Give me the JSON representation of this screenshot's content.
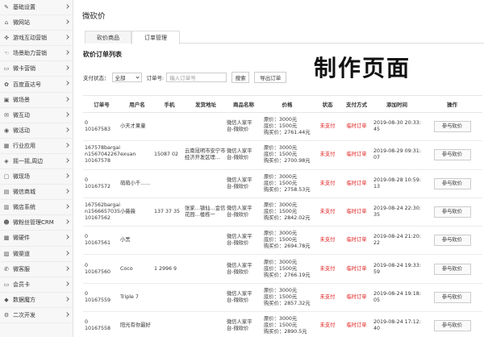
{
  "sidebar": {
    "items": [
      {
        "label": "基础设置",
        "icon": "wrench-icon",
        "glyph": "✎"
      },
      {
        "label": "微网站",
        "icon": "home-icon",
        "glyph": "⌂"
      },
      {
        "label": "游戏互动营销",
        "icon": "gamepad-icon",
        "glyph": "✜"
      },
      {
        "label": "场景助力营销",
        "icon": "hand-icon",
        "glyph": "☜"
      },
      {
        "label": "微卡营销",
        "icon": "card-icon",
        "glyph": "▭"
      },
      {
        "label": "百度直达号",
        "icon": "paw-icon",
        "glyph": "✿"
      },
      {
        "label": "微场景",
        "icon": "picture-icon",
        "glyph": "▣"
      },
      {
        "label": "微互动",
        "icon": "chat-icon",
        "glyph": "✉"
      },
      {
        "label": "微活动",
        "icon": "activity-icon",
        "glyph": "◉"
      },
      {
        "label": "行业应用",
        "icon": "grid-icon",
        "glyph": "▦"
      },
      {
        "label": "摇一摇,周边",
        "icon": "shake-icon",
        "glyph": "◈"
      },
      {
        "label": "微现场",
        "icon": "screen-icon",
        "glyph": "▢"
      },
      {
        "label": "微信商城",
        "icon": "store-icon",
        "glyph": "▤"
      },
      {
        "label": "微店系统",
        "icon": "shop-icon",
        "glyph": "▥"
      },
      {
        "label": "微粉丝管理CRM",
        "icon": "users-icon",
        "glyph": "☻"
      },
      {
        "label": "微硬件",
        "icon": "hardware-icon",
        "glyph": "▩"
      },
      {
        "label": "微渠道",
        "icon": "channel-icon",
        "glyph": "▨"
      },
      {
        "label": "微客服",
        "icon": "service-icon",
        "glyph": "✆"
      },
      {
        "label": "会员卡",
        "icon": "member-card-icon",
        "glyph": "▭"
      },
      {
        "label": "数据魔方",
        "icon": "cube-icon",
        "glyph": "◆"
      },
      {
        "label": "二次开发",
        "icon": "code-icon",
        "glyph": "⚙"
      }
    ]
  },
  "main": {
    "title": "微砍价",
    "tabs": [
      {
        "label": "砍价商品"
      },
      {
        "label": "订单管理"
      }
    ],
    "section_title": "砍价订单列表",
    "overlay_text": "制作页面",
    "filter": {
      "status_label": "支付状态：",
      "status_value": "全部",
      "order_label": "订单号:",
      "order_placeholder": "输入订单号",
      "search_label": "搜索",
      "export_label": "导出订单"
    },
    "columns": [
      "订单号",
      "用户名",
      "手机",
      "发货地址",
      "商品名称",
      "价格",
      "状态",
      "支付方式",
      "添加时间",
      "操作"
    ],
    "rows": [
      {
        "no1": "0",
        "no2": "10167583",
        "no3": "",
        "user": "小天才果童",
        "phone": "",
        "addr": "",
        "prod1": "微信人家平",
        "prod2": "台-微砍价",
        "p1": "原价：3000元",
        "p2": "底价：1500元",
        "p3": "购买价：2761.44元",
        "status": "未支付",
        "pay": "临时订单",
        "time1": "2019-08-30 20:33:",
        "time2": "45",
        "op": "参与砍价"
      },
      {
        "no1": "167578bargai",
        "no2": "n1567042267",
        "no3": "10167578",
        "user": "exuan",
        "phone": "15087 02",
        "addr": "云南昆明市安宁市经济开发区理…",
        "prod1": "微信人家平",
        "prod2": "台-微砍价",
        "p1": "原价：3000元",
        "p2": "底价：1500元",
        "p3": "购买价：2700.98元",
        "status": "未支付",
        "pay": "临时订单",
        "time1": "2019-08-29 09:31:",
        "time2": "07",
        "op": "参与砍价"
      },
      {
        "no1": "0",
        "no2": "10167572",
        "no3": "",
        "user": "萌萌小千……",
        "phone": "",
        "addr": "",
        "prod1": "微信人家平",
        "prod2": "台-微砍价",
        "p1": "原价：3000元",
        "p2": "底价：1500元",
        "p3": "购买价：2758.53元",
        "status": "未支付",
        "pay": "临时订单",
        "time1": "2019-08-28 10:59:",
        "time2": "13",
        "op": "参与砍价"
      },
      {
        "no1": "167562bargai",
        "no2": "n1566657035",
        "no3": "10167562",
        "user": "小薇薇",
        "phone": "137 37 35",
        "addr": "张家…镇仙…金信花园…楼栋一",
        "prod1": "微信人家平",
        "prod2": "台-微砍价",
        "p1": "原价：3000元",
        "p2": "底价：1500元",
        "p3": "购买价：2842.02元",
        "status": "未支付",
        "pay": "临时订单",
        "time1": "2019-08-24 22:30:",
        "time2": "35",
        "op": "参与砍价"
      },
      {
        "no1": "0",
        "no2": "10167561",
        "no3": "",
        "user": "小黑",
        "phone": "",
        "addr": "",
        "prod1": "微信人家平",
        "prod2": "台-微砍价",
        "p1": "原价：3000元",
        "p2": "底价：1500元",
        "p3": "购买价：2694.78元",
        "status": "未支付",
        "pay": "临时订单",
        "time1": "2019-08-24 21:20:",
        "time2": "22",
        "op": "参与砍价"
      },
      {
        "no1": "0",
        "no2": "10167560",
        "no3": "",
        "user": "Coco",
        "phone": "1 2996 9",
        "addr": "",
        "prod1": "微信人家平",
        "prod2": "台-微砍价",
        "p1": "原价：3000元",
        "p2": "底价：1500元",
        "p3": "购买价：2766.19元",
        "status": "未支付",
        "pay": "临时订单",
        "time1": "2019-08-24 19:33:",
        "time2": "59",
        "op": "参与砍价"
      },
      {
        "no1": "0",
        "no2": "10167559",
        "no3": "",
        "user": "Triple 7",
        "phone": "",
        "addr": "",
        "prod1": "微信人家平",
        "prod2": "台-微砍价",
        "p1": "原价：3000元",
        "p2": "底价：1500元",
        "p3": "购买价：2857.32元",
        "status": "未支付",
        "pay": "临时订单",
        "time1": "2019-08-24 19:18:",
        "time2": "05",
        "op": "参与砍价"
      },
      {
        "no1": "0",
        "no2": "10167558",
        "no3": "",
        "user": "阳光有你最好",
        "phone": "",
        "addr": "",
        "prod1": "微信人家平",
        "prod2": "台-微砍价",
        "p1": "原价：3000元",
        "p2": "底价：1500元",
        "p3": "购买价：2890.5元",
        "status": "未支付",
        "pay": "临时订单",
        "time1": "2019-08-24 17:12:",
        "time2": "40",
        "op": "参与砍价"
      }
    ]
  },
  "colors": {
    "status_red": "#e02020",
    "sidebar_bg": "#f7f7f7"
  }
}
